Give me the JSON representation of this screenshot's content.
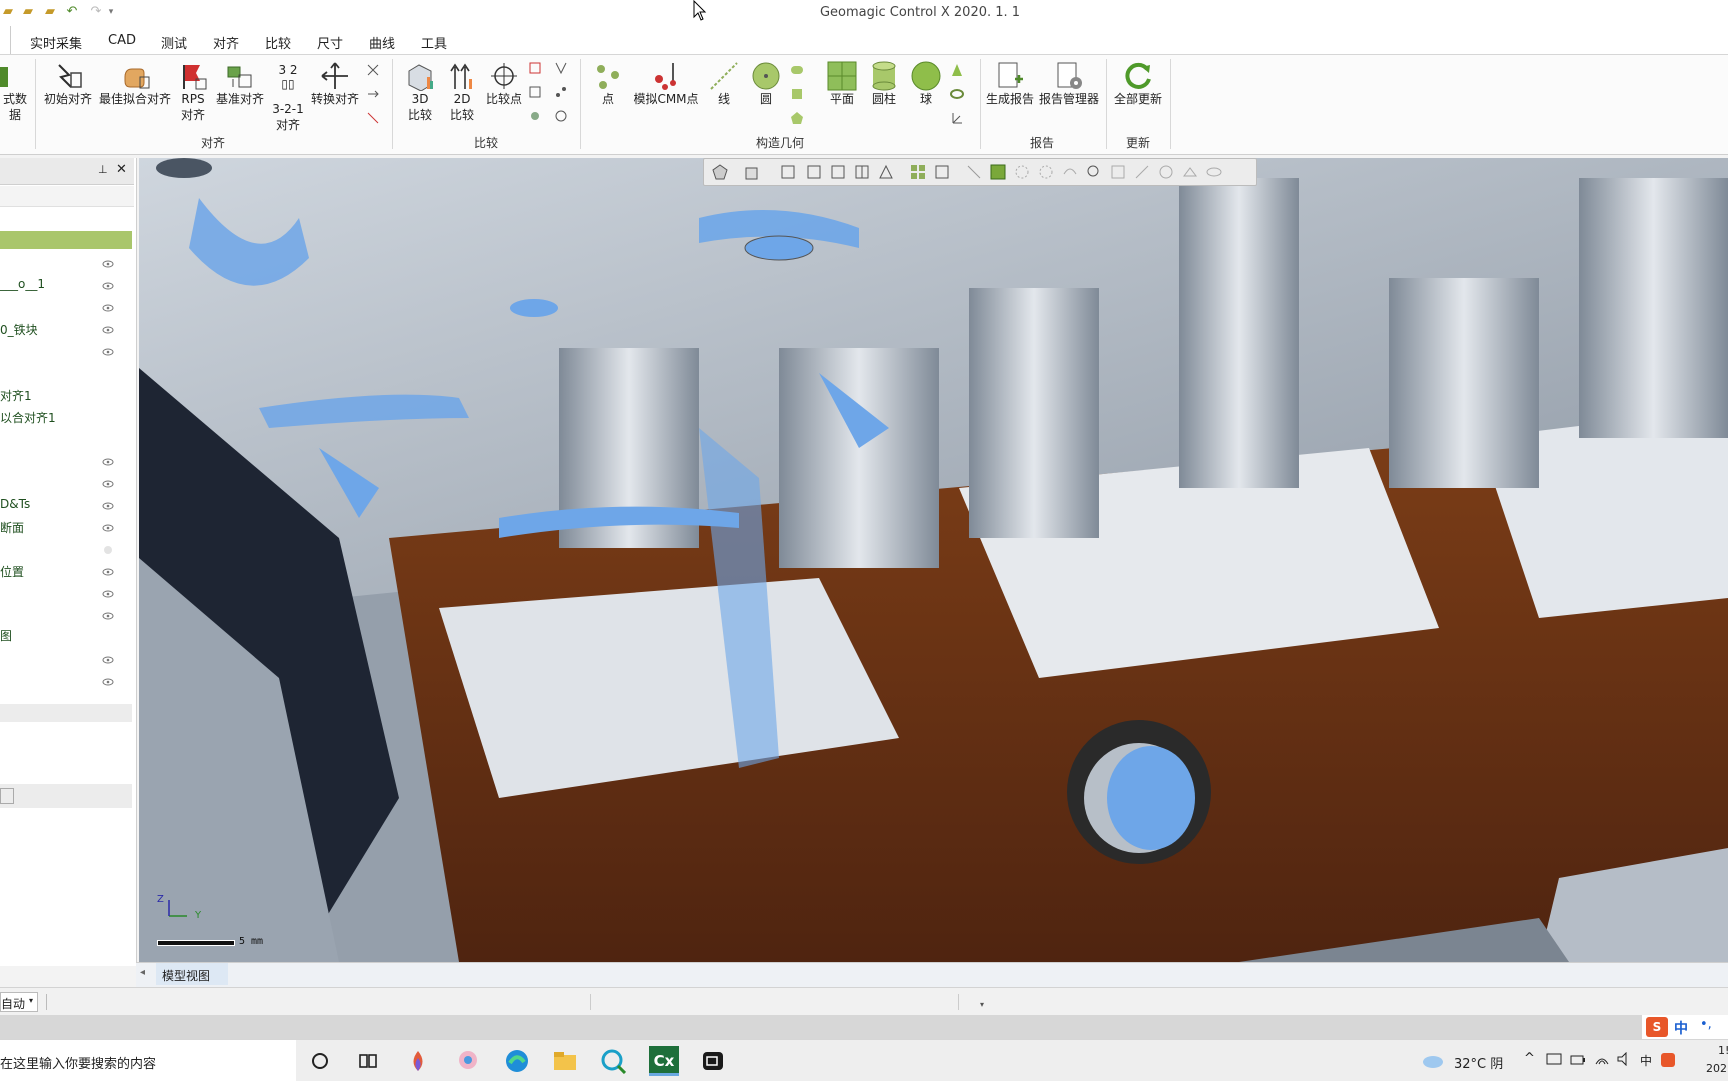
{
  "app": {
    "title": "Geomagic Control X 2020. 1. 1"
  },
  "quick_access": [
    "open-icon",
    "folder-icon",
    "folder-open-icon",
    "undo-icon",
    "redo-icon",
    "customize-icon"
  ],
  "tabs": [
    {
      "label": "实时采集"
    },
    {
      "label": "CAD"
    },
    {
      "label": "测试"
    },
    {
      "label": "对齐"
    },
    {
      "label": "比较"
    },
    {
      "label": "尺寸"
    },
    {
      "label": "曲线"
    },
    {
      "label": "工具"
    }
  ],
  "ribbon": {
    "partial_left_label": "式数据",
    "align": {
      "group_label": "对齐",
      "initial": "初始对齐",
      "best_fit": "最佳拟合对齐",
      "rps_line1": "RPS",
      "rps_line2": "对齐",
      "datum": "基准对齐",
      "three21_top": "3 2",
      "three21_line1": "3-2-1",
      "three21_line2": "对齐",
      "transform": "转换对齐"
    },
    "compare": {
      "group_label": "比较",
      "c3d_line1": "3D",
      "c3d_line2": "比较",
      "c2d_line1": "2D",
      "c2d_line2": "比较",
      "compare_point": "比较点"
    },
    "construct": {
      "group_label": "构造几何",
      "point": "点",
      "sim_cmm": "模拟CMM点",
      "line": "线",
      "circle": "圆",
      "plane": "平面",
      "cylinder": "圆柱",
      "sphere": "球"
    },
    "report": {
      "group_label": "报告",
      "generate": "生成报告",
      "manager": "报告管理器"
    },
    "update": {
      "group_label": "更新",
      "update_all": "全部更新"
    }
  },
  "tree": {
    "items": [
      {
        "label": "___o__1"
      },
      {
        "label": "0_铁块"
      },
      {
        "label": "对齐1"
      },
      {
        "label": "以合对齐1"
      },
      {
        "label": "D&Ts"
      },
      {
        "label": "断面"
      },
      {
        "label": "位置"
      },
      {
        "label": "图"
      }
    ]
  },
  "viewport": {
    "scale_label": "5 mm",
    "axis_x": "Y",
    "axis_z": "Z"
  },
  "view_tabs": {
    "model_view": "模型视图"
  },
  "status": {
    "mode": "自动"
  },
  "taskbar": {
    "search_placeholder": "在这里输入你要搜索的内容",
    "weather": "32°C 阴",
    "ime": "中",
    "clock_partial_time": "1!",
    "clock_partial_date": "202"
  },
  "colors": {
    "accent_green": "#5e8f2c",
    "tab_active_bg": "#b7d07a",
    "mesh_metal": "#b9c3cf",
    "deviation_blue": "#6ea6e8",
    "deviation_brown": "#7a3a1a"
  }
}
